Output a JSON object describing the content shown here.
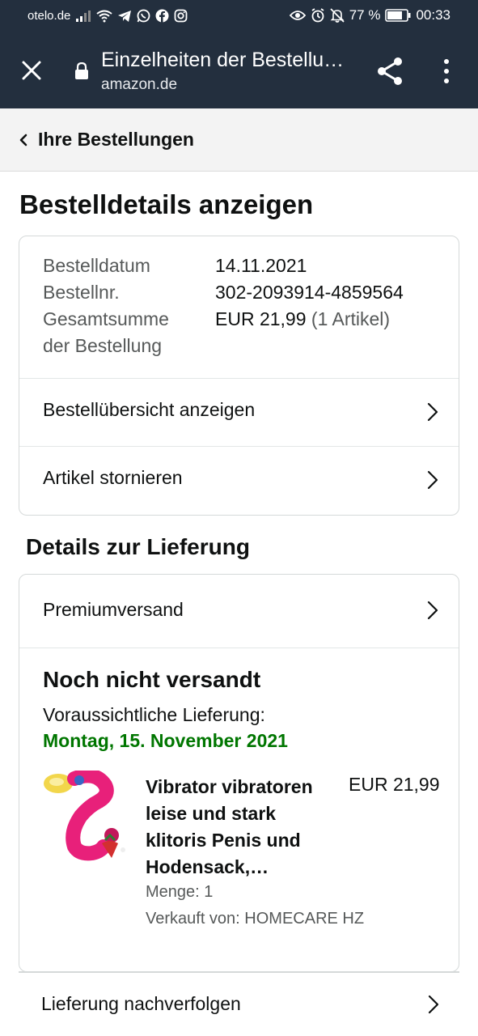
{
  "status_bar": {
    "carrier": "otelo.de",
    "battery": "77 %",
    "time": "00:33",
    "icons_left": [
      "signal-icon",
      "wifi-icon",
      "telegram-icon",
      "whatsapp-icon",
      "facebook-icon",
      "instagram-icon"
    ],
    "icons_right": [
      "eye-icon",
      "alarm-icon",
      "bell-off-icon",
      "battery-icon"
    ]
  },
  "browser": {
    "title": "Einzelheiten der Bestellu…",
    "url": "amazon.de",
    "toolbar_color": "#232f3e"
  },
  "breadcrumb": {
    "label": "Ihre Bestellungen"
  },
  "page": {
    "title": "Bestelldetails anzeigen"
  },
  "order_summary": {
    "date_label": "Bestelldatum",
    "date_value": "14.11.2021",
    "number_label": "Bestellnr.",
    "number_value": "302-2093914-4859564",
    "total_label_line1": "Gesamtsumme",
    "total_label_line2": "der Bestellung",
    "total_value": "EUR 21,99",
    "total_items": "(1 Artikel)"
  },
  "order_links": {
    "overview": "Bestellübersicht anzeigen",
    "cancel": "Artikel stornieren"
  },
  "delivery": {
    "section_title": "Details zur Lieferung",
    "shipping_method": "Premiumversand",
    "status": "Noch nicht versandt",
    "eta_label": "Voraussichtliche Lieferung:",
    "eta_date": "Montag, 15. November 2021",
    "eta_color": "#007600"
  },
  "product": {
    "title": "Vibrator vibratoren leise und stark klitoris Penis und Hodensack,…",
    "price": "EUR 21,99",
    "quantity": "Menge: 1",
    "seller": "Verkauft von: HOMECARE HZ",
    "image_color": "#e8207a"
  },
  "tracking": {
    "label": "Lieferung nachverfolgen"
  }
}
